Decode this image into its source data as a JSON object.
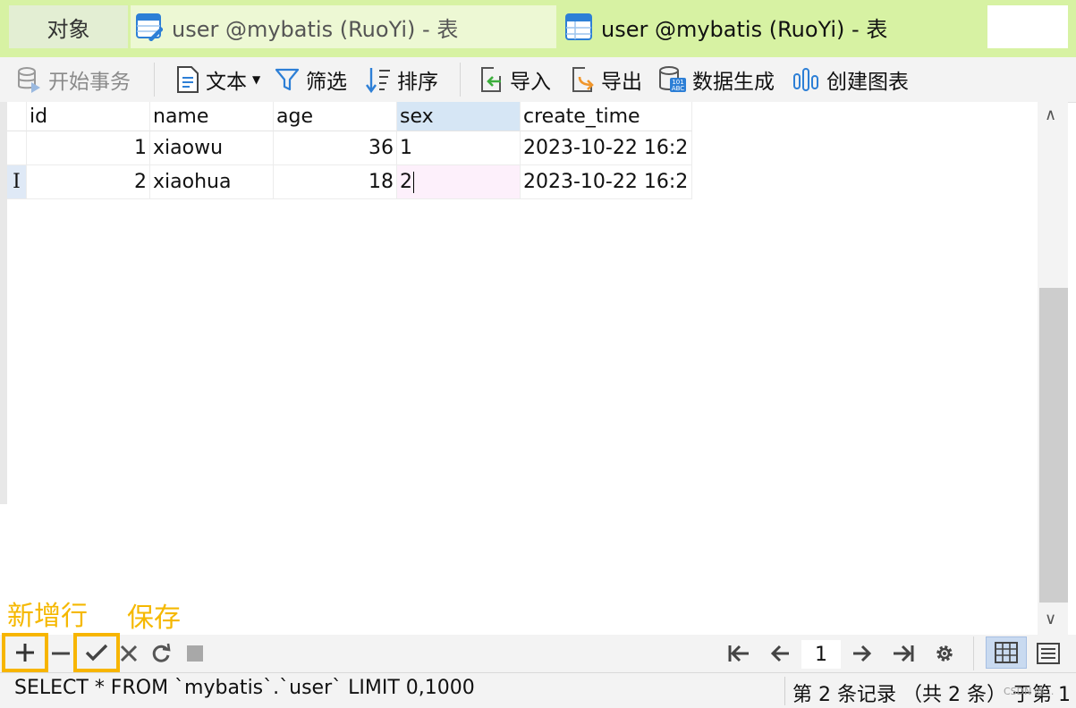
{
  "tabs": {
    "objects": "对象",
    "tab1": "user @mybatis (RuoYi) - 表",
    "tab2": "user @mybatis (RuoYi) - 表"
  },
  "toolbar": {
    "begin_transaction": "开始事务",
    "text": "文本",
    "filter": "筛选",
    "sort": "排序",
    "import": "导入",
    "export": "导出",
    "data_generation": "数据生成",
    "create_chart": "创建图表"
  },
  "grid": {
    "columns": [
      "id",
      "name",
      "age",
      "sex",
      "create_time"
    ],
    "selected_column": "sex",
    "rows": [
      {
        "id": "1",
        "name": "xiaowu",
        "age": "36",
        "sex": "1",
        "create_time": "2023-10-22 16:2"
      },
      {
        "id": "2",
        "name": "xiaohua",
        "age": "18",
        "sex": "2",
        "create_time": "2023-10-22 16:2"
      }
    ],
    "active_row_marker": "I"
  },
  "annotations": {
    "add_row": "新增行",
    "save": "保存"
  },
  "bottom": {
    "page_number": "1"
  },
  "status": {
    "sql": "SELECT * FROM `mybatis`.`user` LIMIT 0,1000",
    "records": "第 2 条记录 （共 2 条） 于第 1",
    "watermark": "CSDN @..."
  },
  "colors": {
    "tab_active": "#d7f2a3",
    "highlight": "#f7b500",
    "selected_header": "#d6e6f5"
  }
}
